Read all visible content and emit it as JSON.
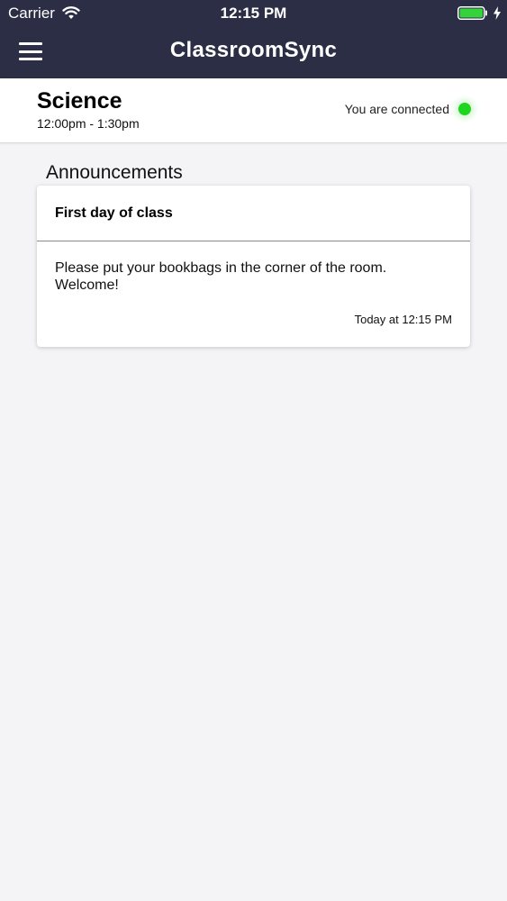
{
  "status_bar": {
    "carrier": "Carrier",
    "time": "12:15 PM",
    "icons": [
      "wifi-icon",
      "battery-icon",
      "charging-bolt-icon"
    ],
    "battery_level": 1.0
  },
  "nav": {
    "menu_icon": "hamburger-menu-icon",
    "title": "ClassroomSync"
  },
  "class_info": {
    "name": "Science",
    "time": "12:00pm - 1:30pm",
    "connection_status": "You are connected",
    "connection_color": "#1fd51f"
  },
  "announcements": {
    "heading": "Announcements",
    "items": [
      {
        "title": "First day of class",
        "body": "Please put your bookbags in the corner of the room. Welcome!",
        "time": "Today at 12:15 PM"
      }
    ]
  },
  "colors": {
    "nav_background": "#2b2e45",
    "page_background": "#f4f3f5",
    "card_background": "#ffffff"
  }
}
